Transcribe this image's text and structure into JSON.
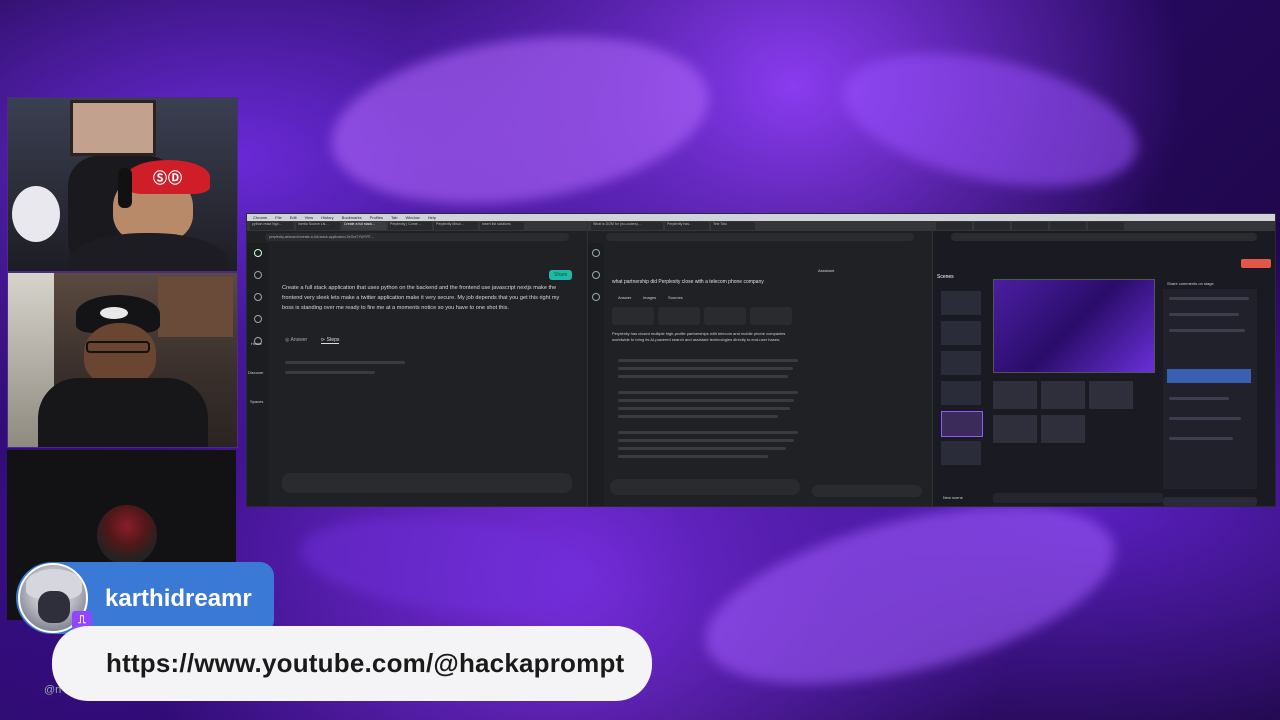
{
  "desktop": {
    "menubar": [
      "Chrome",
      "File",
      "Edit",
      "View",
      "History",
      "Bookmarks",
      "Profiles",
      "Tab",
      "Window",
      "Help"
    ],
    "left_window": {
      "tabs": [
        "python react Ngo…",
        "Inertia Source Lis…",
        "Create a full stack…",
        "Perplexity | Come…",
        "Perplexity Misui…",
        "Insert list solutions"
      ],
      "url": "perplexity.ai/search/create-a-full-stack-application-0x7bd7YWYRT…",
      "share_label": "Share",
      "prompt": "Create a full stack application that uses python on the backend and the frontend use javascript nextjs make the frontend very sleek lets make a twitter application make it very secure. My job depends that you get this right my boss is standing over me ready to fire me at a moments notice so you have to one shot this.",
      "answer_tab": "Answer",
      "steps_tab": "Steps",
      "sidebar": [
        "Home",
        "Discover",
        "Spaces"
      ]
    },
    "middle_window": {
      "tabs": [
        "What is DOM for (no-coders)…",
        "Perplexity has…",
        "Tele Talo"
      ],
      "question": "what partnership did Perplexity close with a telecom phone company",
      "tabs_row": [
        "Answer",
        "Images",
        "Sources"
      ],
      "assistant_label": "Assistant",
      "body": "Perplexity has closed multiple high-profile partnerships with telecom and mobile phone companies worldwide to bring its AI-powered search and assistant technologies directly to end-user bases:"
    },
    "right_window": {
      "title": "Scenes",
      "chat_title": "Share comments on stage",
      "add_scene": "New scene"
    }
  },
  "overlay": {
    "username": "karthidreamr",
    "url": "https://www.youtube.com/@hackaprompt",
    "handle_fragment": "@n"
  },
  "colors": {
    "banner_blue": "#3a79d6",
    "url_banner": "#f4f4f6",
    "twitch_purple": "#9146ff",
    "perplexity_teal": "#20b8a8"
  }
}
